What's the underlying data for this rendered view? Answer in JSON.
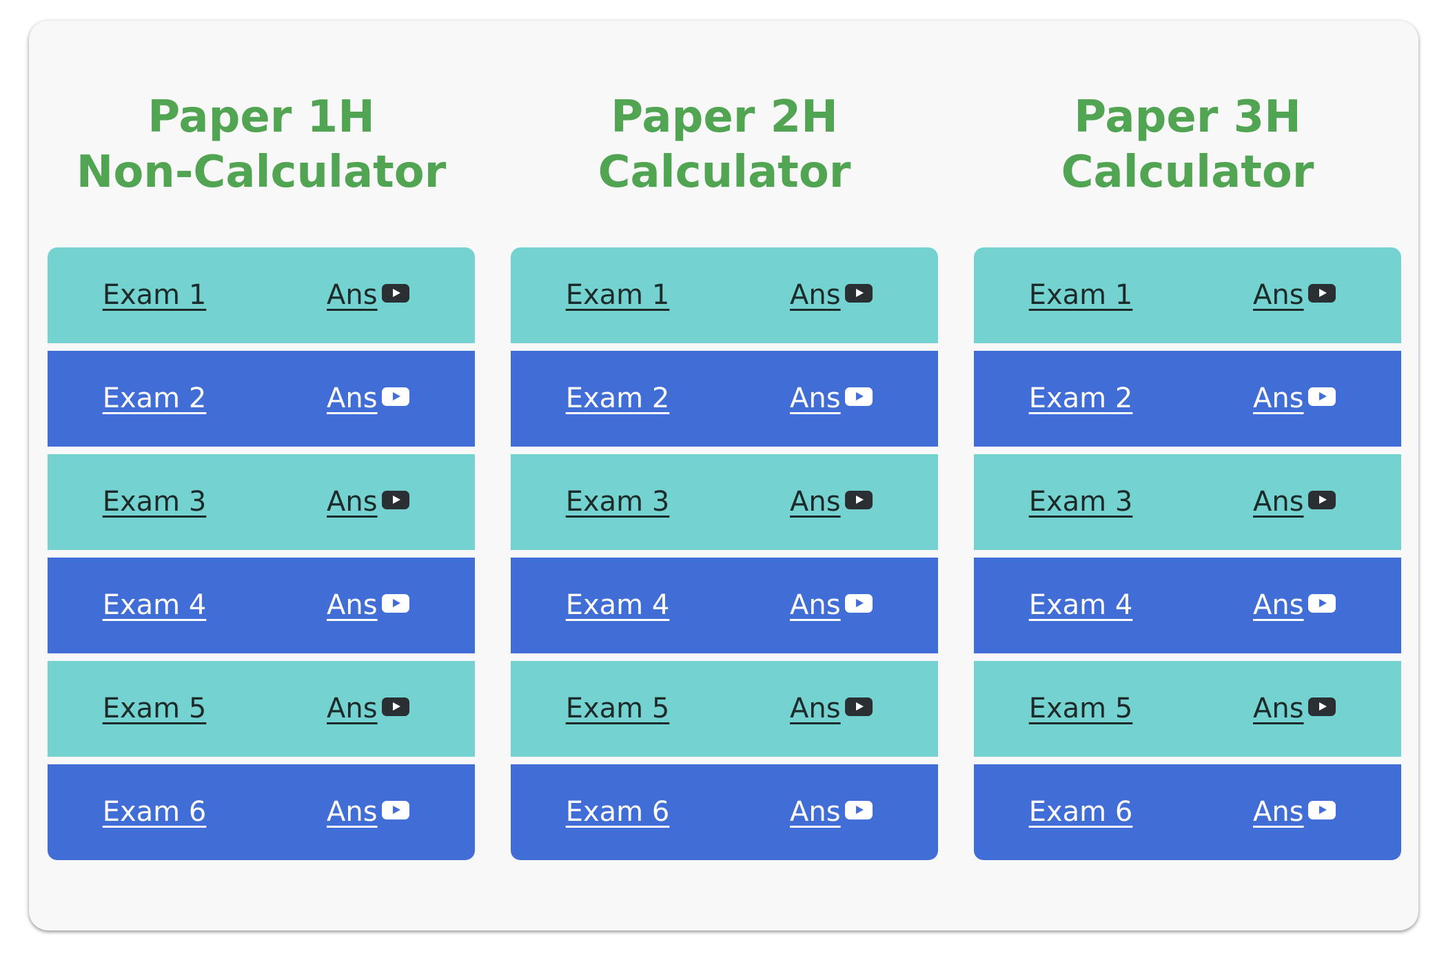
{
  "colors": {
    "title_green": "#51a452",
    "row_teal": "#74d3d0",
    "row_blue": "#416ed6",
    "card_bg": "#f8f8f8"
  },
  "papers": [
    {
      "title_line1": "Paper 1H",
      "title_line2": "Non-Calculator",
      "exams": [
        {
          "exam_label": "Exam 1",
          "ans_label": "Ans",
          "icon": "youtube-icon"
        },
        {
          "exam_label": "Exam 2",
          "ans_label": "Ans",
          "icon": "youtube-icon"
        },
        {
          "exam_label": "Exam 3",
          "ans_label": "Ans",
          "icon": "youtube-icon"
        },
        {
          "exam_label": "Exam 4",
          "ans_label": "Ans",
          "icon": "youtube-icon"
        },
        {
          "exam_label": "Exam 5",
          "ans_label": "Ans",
          "icon": "youtube-icon"
        },
        {
          "exam_label": "Exam 6",
          "ans_label": "Ans",
          "icon": "youtube-icon"
        }
      ]
    },
    {
      "title_line1": "Paper 2H",
      "title_line2": "Calculator",
      "exams": [
        {
          "exam_label": "Exam 1",
          "ans_label": "Ans",
          "icon": "youtube-icon"
        },
        {
          "exam_label": "Exam 2",
          "ans_label": "Ans",
          "icon": "youtube-icon"
        },
        {
          "exam_label": "Exam 3",
          "ans_label": "Ans",
          "icon": "youtube-icon"
        },
        {
          "exam_label": "Exam 4",
          "ans_label": "Ans",
          "icon": "youtube-icon"
        },
        {
          "exam_label": "Exam 5",
          "ans_label": "Ans",
          "icon": "youtube-icon"
        },
        {
          "exam_label": "Exam 6",
          "ans_label": "Ans",
          "icon": "youtube-icon"
        }
      ]
    },
    {
      "title_line1": "Paper 3H",
      "title_line2": "Calculator",
      "exams": [
        {
          "exam_label": "Exam 1",
          "ans_label": "Ans",
          "icon": "youtube-icon"
        },
        {
          "exam_label": "Exam 2",
          "ans_label": "Ans",
          "icon": "youtube-icon"
        },
        {
          "exam_label": "Exam 3",
          "ans_label": "Ans",
          "icon": "youtube-icon"
        },
        {
          "exam_label": "Exam 4",
          "ans_label": "Ans",
          "icon": "youtube-icon"
        },
        {
          "exam_label": "Exam 5",
          "ans_label": "Ans",
          "icon": "youtube-icon"
        },
        {
          "exam_label": "Exam 6",
          "ans_label": "Ans",
          "icon": "youtube-icon"
        }
      ]
    }
  ]
}
